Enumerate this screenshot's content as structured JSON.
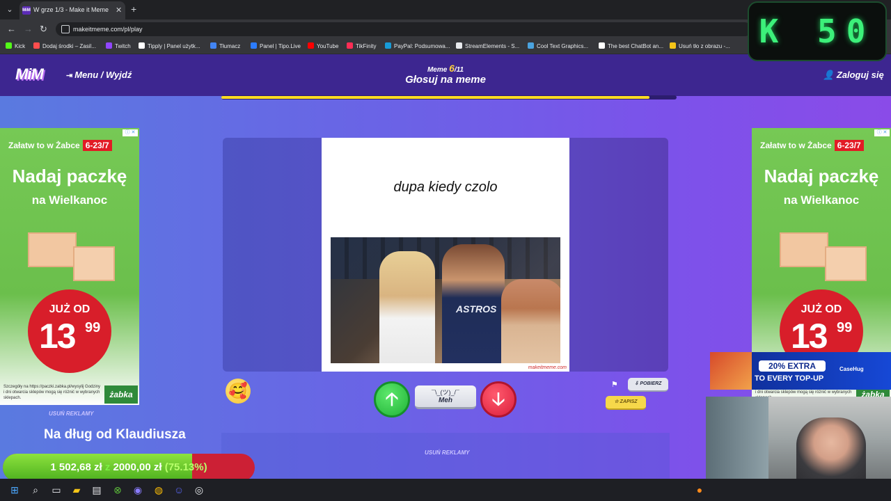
{
  "browser": {
    "tab_title": "W grze 1/3 - Make it Meme",
    "tab_favicon": "MiM",
    "url": "makeitmeme.com/pl/play",
    "bookmarks": [
      {
        "label": "Kick",
        "color": "#53fc18"
      },
      {
        "label": "Dodaj środki – Zasil...",
        "color": "#ff4d4d"
      },
      {
        "label": "Twitch",
        "color": "#9146ff"
      },
      {
        "label": "Tipply | Panel użytk...",
        "color": "#ffffff"
      },
      {
        "label": "Tłumacz",
        "color": "#4285f4"
      },
      {
        "label": "Panel | Tipo.Live",
        "color": "#2b7cff"
      },
      {
        "label": "YouTube",
        "color": "#ff0000"
      },
      {
        "label": "TikFinity",
        "color": "#ff2d55"
      },
      {
        "label": "PayPal: Podsumowa...",
        "color": "#179bd7"
      },
      {
        "label": "StreamElements - S...",
        "color": "#e8eaed"
      },
      {
        "label": "Cool Text Graphics...",
        "color": "#4aa3df"
      },
      {
        "label": "The best ChatBot an...",
        "color": "#ffffff"
      },
      {
        "label": "Usuń tło z obrazu -...",
        "color": "#f5c518"
      }
    ]
  },
  "site": {
    "logo": "MiM",
    "menu_label": "Menu / Wyjdź",
    "meme_prefix": "Meme",
    "meme_current": "6",
    "meme_total": "/11",
    "round_title": "Głosuj na meme",
    "login_label": "Zaloguj się",
    "progress": 0.94
  },
  "meme": {
    "caption": "dupa kiedy czolo",
    "shirt_text": "ASTROS",
    "watermark": "makeitmeme.com"
  },
  "controls": {
    "up_symbol": "🡡",
    "meh_face": "¯\\_(ツ)_/¯",
    "meh_label": "Meh",
    "down_symbol": "🡣",
    "download_label": "POBIERZ",
    "save_label": "ZAPISZ",
    "emoji": "🥰"
  },
  "ads": {
    "tag": "Załatw to w Żabce",
    "date": "6-23/7",
    "headline": "Nadaj paczkę",
    "subline": "na Wielkanoc",
    "price_label": "JUŻ OD",
    "price_whole": "13",
    "price_cents": "99",
    "fine_print": "Szczegóły na https://paczki.zabka.pl/wysylij Godziny i dni otwarcia sklepów mogą się różnić w wybranych sklepach.",
    "brand": "żabka",
    "choices": "ⓘ ✕",
    "remove_ads": "USUŃ REKLAMY"
  },
  "overlay": {
    "kick_counter": "K 50",
    "debt_label": "Na dług od Klaudiusza",
    "goal_current": "1 502,68 zł",
    "goal_sep": "z",
    "goal_total": "2000,00 zł",
    "goal_percent": "(75.13%)",
    "goal_fraction": 0.7513,
    "promo_pill": "20% EXTRA",
    "promo_sub": "TO EVERY TOP-UP",
    "promo_brand": "CaseHug"
  },
  "colors": {
    "header": "#3d2690",
    "progress": "#ffdc23",
    "vote_up": "#20b338",
    "vote_down": "#db1f3c"
  }
}
